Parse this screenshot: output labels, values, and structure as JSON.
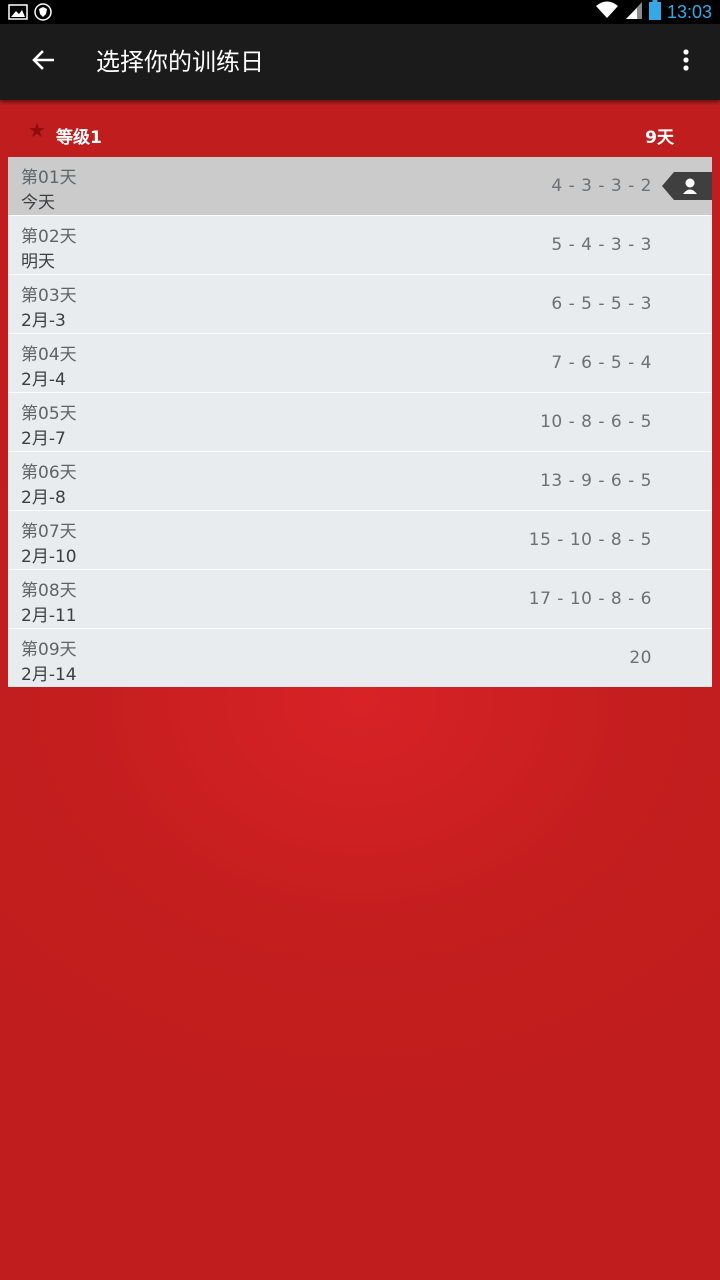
{
  "status_bar": {
    "time": "13:03",
    "icons": [
      "gallery-icon",
      "shield-icon",
      "wifi-icon",
      "cell-signal-icon",
      "battery-icon"
    ]
  },
  "app_bar": {
    "title": "选择你的训练日",
    "back_icon": "arrow-left-icon",
    "menu_icon": "more-vert-icon"
  },
  "level": {
    "label": "等级1",
    "total_days": "9天",
    "icon": "star-icon"
  },
  "days": [
    {
      "day": "第01天",
      "date": "今天",
      "reps": "4 - 3 - 3 - 2",
      "selected": true
    },
    {
      "day": "第02天",
      "date": "明天",
      "reps": "5 - 4 - 3 - 3"
    },
    {
      "day": "第03天",
      "date": "2月-3",
      "reps": "6 - 5 - 5 - 3"
    },
    {
      "day": "第04天",
      "date": "2月-4",
      "reps": "7 - 6 - 5 - 4"
    },
    {
      "day": "第05天",
      "date": "2月-7",
      "reps": "10 - 8 - 6 - 5"
    },
    {
      "day": "第06天",
      "date": "2月-8",
      "reps": "13 - 9 - 6 - 5"
    },
    {
      "day": "第07天",
      "date": "2月-10",
      "reps": "15 - 10 - 8 - 5"
    },
    {
      "day": "第08天",
      "date": "2月-11",
      "reps": "17 - 10 - 8 - 6"
    },
    {
      "day": "第09天",
      "date": "2月-14",
      "reps": "20"
    }
  ],
  "colors": {
    "background": "#c41e1f",
    "app_bar": "#1b1b1b",
    "row": "#e8ecef",
    "row_selected": "#cbcbcb",
    "status_accent": "#35a8e6"
  }
}
